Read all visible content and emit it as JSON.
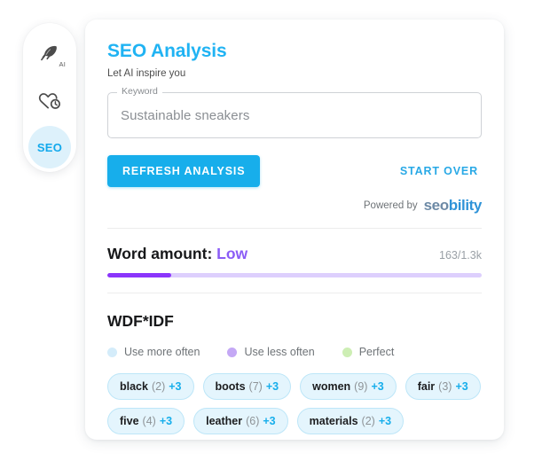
{
  "sidebar": {
    "items": [
      {
        "name": "ai-writer",
        "icon": "feather-ai-icon",
        "label": "AI",
        "active": false
      },
      {
        "name": "history",
        "icon": "heart-clock-icon",
        "label": "",
        "active": false
      },
      {
        "name": "seo",
        "icon": "seo-text-icon",
        "label": "SEO",
        "active": true
      }
    ]
  },
  "card": {
    "title": "SEO Analysis",
    "subtitle": "Let AI inspire you",
    "keyword_field": {
      "legend": "Keyword",
      "value": "Sustainable sneakers",
      "placeholder": "Sustainable sneakers"
    },
    "actions": {
      "primary_label": "REFRESH ANALYSIS",
      "secondary_label": "START OVER"
    },
    "powered_by": {
      "text": "Powered by",
      "logo_part1": "seo",
      "logo_part2": "bility"
    },
    "word_amount": {
      "label": "Word amount:",
      "value": "Low",
      "count": "163/1.3k",
      "progress_percent": 17
    },
    "wdf_idf": {
      "title": "WDF*IDF",
      "legend": [
        {
          "label": "Use more often",
          "color": "#d4ecfa"
        },
        {
          "label": "Use less often",
          "color": "#c4a8f5"
        },
        {
          "label": "Perfect",
          "color": "#cdeeb4"
        }
      ],
      "chips": [
        {
          "word": "black",
          "count": "(2)",
          "delta": "+3"
        },
        {
          "word": "boots",
          "count": "(7)",
          "delta": "+3"
        },
        {
          "word": "women",
          "count": "(9)",
          "delta": "+3"
        },
        {
          "word": "fair",
          "count": "(3)",
          "delta": "+3"
        },
        {
          "word": "five",
          "count": "(4)",
          "delta": "+3"
        },
        {
          "word": "leather",
          "count": "(6)",
          "delta": "+3"
        },
        {
          "word": "materials",
          "count": "(2)",
          "delta": "+3"
        }
      ]
    }
  },
  "colors": {
    "accent": "#17aeeb",
    "title": "#20b3f3",
    "purple": "#8b5cf6",
    "progress_fill": "#8b35fb",
    "progress_track": "#ddcffd",
    "chip_bg": "#e4f5fd",
    "chip_border": "#bde6f8",
    "active_rail_bg": "#ddf1fb"
  }
}
